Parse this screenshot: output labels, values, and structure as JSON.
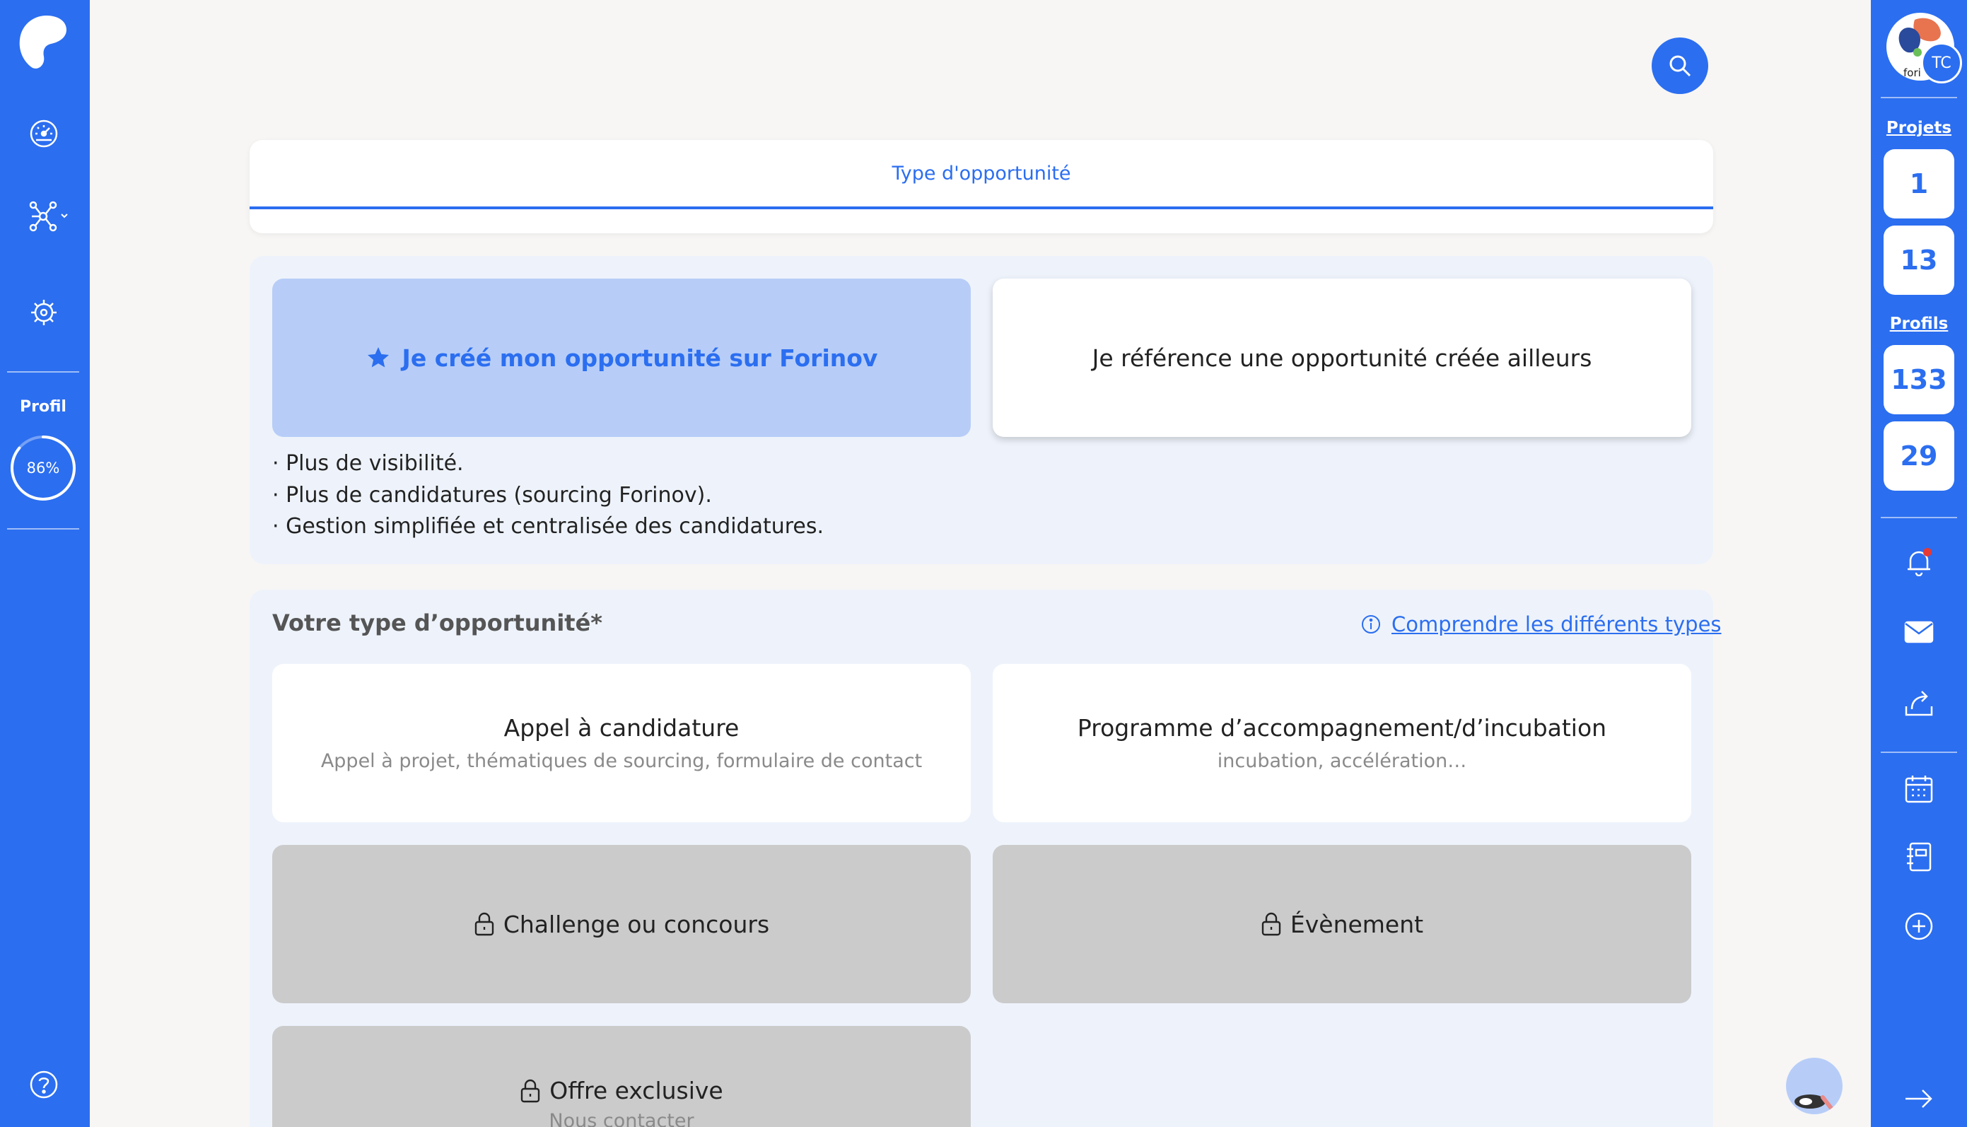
{
  "left_sidebar": {
    "profile_label": "Profil",
    "profile_progress_text": "86%",
    "profile_progress": 0.86
  },
  "right_sidebar": {
    "avatar_initials": "TC",
    "avatar_brand_text": "fori",
    "projects_label": "Projets",
    "projects_counts": [
      "1",
      "13"
    ],
    "profiles_label": "Profils",
    "profiles_counts": [
      "133",
      "29"
    ]
  },
  "tabs": {
    "active_label": "Type d'opportunité"
  },
  "creation_mode": {
    "option_forinov": "Je créé mon opportunité sur Forinov",
    "option_external": "Je référence une opportunité créée ailleurs",
    "benefits": [
      "· Plus de visibilité.",
      "· Plus de candidatures (sourcing Forinov).",
      "· Gestion simplifiée et centralisée des candidatures."
    ]
  },
  "opportunity_type": {
    "title": "Votre type d’opportunité*",
    "help_link": "Comprendre les différents types",
    "cards": [
      {
        "title": "Appel à candidature",
        "subtitle": "Appel à projet, thématiques de sourcing, formulaire de contact",
        "locked": false
      },
      {
        "title": "Programme d’accompagnement/d’incubation",
        "subtitle": "incubation, accélération…",
        "locked": false
      },
      {
        "title": "Challenge ou concours",
        "subtitle": "",
        "locked": true
      },
      {
        "title": "Évènement",
        "subtitle": "",
        "locked": true
      },
      {
        "title": "Offre exclusive",
        "subtitle": "Nous contacter",
        "locked": true
      }
    ]
  },
  "colors": {
    "brand_blue": "#2b6ef0",
    "active_choice_bg": "#b7cdf8",
    "locked_card_bg": "#cbcbcb",
    "panel_bg": "#eef3fb"
  }
}
